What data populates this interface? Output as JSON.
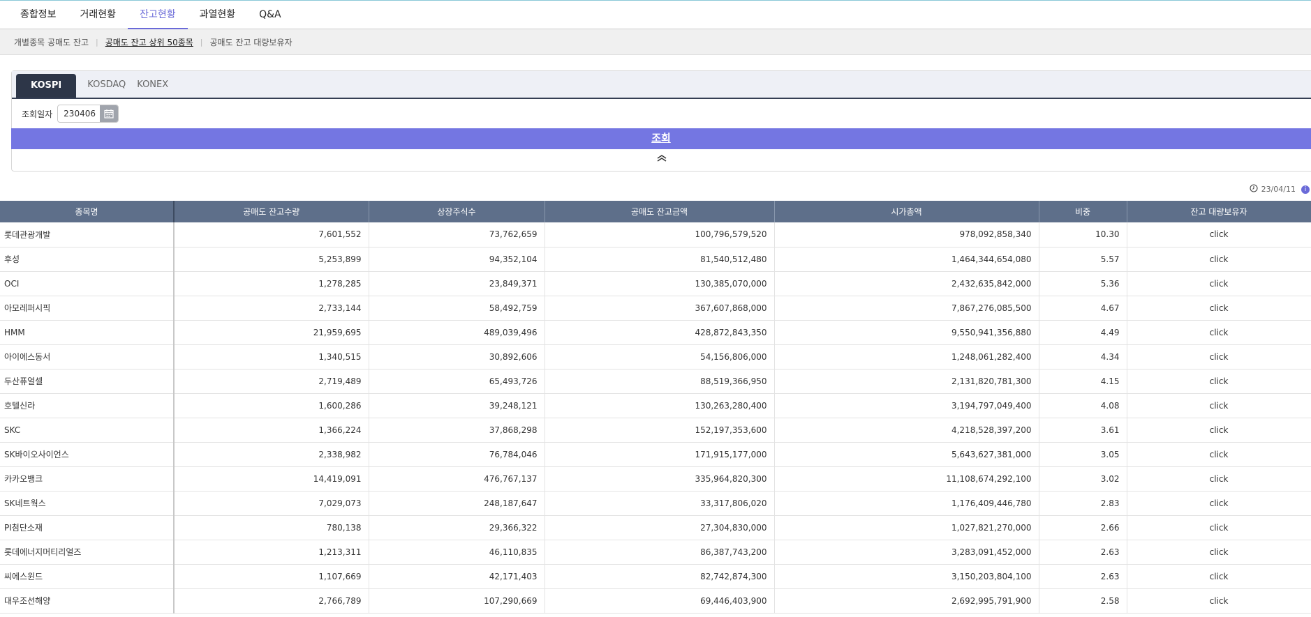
{
  "top_nav": [
    "종합정보",
    "거래현황",
    "잔고현황",
    "과열현황",
    "Q&A"
  ],
  "sub_nav": [
    "개별종목 공매도 잔고",
    "공매도 잔고 상위 50종목",
    "공매도 잔고 대량보유자"
  ],
  "market_tabs": [
    "KOSPI",
    "KOSDAQ",
    "KONEX"
  ],
  "search": {
    "date_label": "조회일자",
    "date_value": "230406",
    "button_label": "조회"
  },
  "date_stamp": "23/04/11",
  "table": {
    "headers": [
      "종목명",
      "공매도 잔고수량",
      "상장주식수",
      "공매도 잔고금액",
      "시가총액",
      "비중",
      "잔고 대량보유자"
    ],
    "rows": [
      [
        "롯데관광개발",
        "7,601,552",
        "73,762,659",
        "100,796,579,520",
        "978,092,858,340",
        "10.30",
        "click"
      ],
      [
        "후성",
        "5,253,899",
        "94,352,104",
        "81,540,512,480",
        "1,464,344,654,080",
        "5.57",
        "click"
      ],
      [
        "OCI",
        "1,278,285",
        "23,849,371",
        "130,385,070,000",
        "2,432,635,842,000",
        "5.36",
        "click"
      ],
      [
        "아모레퍼시픽",
        "2,733,144",
        "58,492,759",
        "367,607,868,000",
        "7,867,276,085,500",
        "4.67",
        "click"
      ],
      [
        "HMM",
        "21,959,695",
        "489,039,496",
        "428,872,843,350",
        "9,550,941,356,880",
        "4.49",
        "click"
      ],
      [
        "아이에스동서",
        "1,340,515",
        "30,892,606",
        "54,156,806,000",
        "1,248,061,282,400",
        "4.34",
        "click"
      ],
      [
        "두산퓨얼셀",
        "2,719,489",
        "65,493,726",
        "88,519,366,950",
        "2,131,820,781,300",
        "4.15",
        "click"
      ],
      [
        "호텔신라",
        "1,600,286",
        "39,248,121",
        "130,263,280,400",
        "3,194,797,049,400",
        "4.08",
        "click"
      ],
      [
        "SKC",
        "1,366,224",
        "37,868,298",
        "152,197,353,600",
        "4,218,528,397,200",
        "3.61",
        "click"
      ],
      [
        "SK바이오사이언스",
        "2,338,982",
        "76,784,046",
        "171,915,177,000",
        "5,643,627,381,000",
        "3.05",
        "click"
      ],
      [
        "카카오뱅크",
        "14,419,091",
        "476,767,137",
        "335,964,820,300",
        "11,108,674,292,100",
        "3.02",
        "click"
      ],
      [
        "SK네트웍스",
        "7,029,073",
        "248,187,647",
        "33,317,806,020",
        "1,176,409,446,780",
        "2.83",
        "click"
      ],
      [
        "PI첨단소재",
        "780,138",
        "29,366,322",
        "27,304,830,000",
        "1,027,821,270,000",
        "2.66",
        "click"
      ],
      [
        "롯데에너지머티리얼즈",
        "1,213,311",
        "46,110,835",
        "86,387,743,200",
        "3,283,091,452,000",
        "2.63",
        "click"
      ],
      [
        "씨에스윈드",
        "1,107,669",
        "42,171,403",
        "82,742,874,300",
        "3,150,203,804,100",
        "2.63",
        "click"
      ],
      [
        "대우조선해양",
        "2,766,789",
        "107,290,669",
        "69,446,403,900",
        "2,692,995,791,900",
        "2.58",
        "click"
      ]
    ]
  }
}
